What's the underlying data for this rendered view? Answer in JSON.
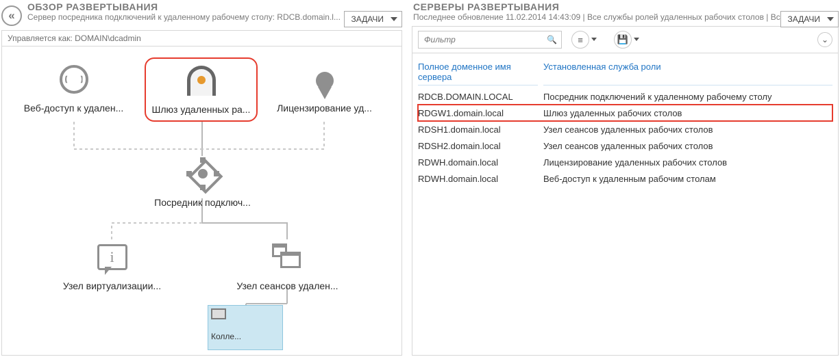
{
  "left": {
    "title": "ОБЗОР РАЗВЕРТЫВАНИЯ",
    "subtitle": "Сервер посредника подключений к удаленному рабочему столу: RDCB.domain.l...",
    "tasks": "ЗАДАЧИ",
    "managed_as": "Управляется как: DOMAIN\\dcadmin",
    "nodes": {
      "web": "Веб-доступ к удален...",
      "gateway": "Шлюз удаленных ра...",
      "licensing": "Лицензирование уд...",
      "broker": "Посредник подключ...",
      "virt": "Узел виртуализации...",
      "session": "Узел сеансов удален..."
    },
    "collection": "Колле..."
  },
  "right": {
    "title": "СЕРВЕРЫ РАЗВЕРТЫВАНИЯ",
    "subtitle": "Последнее обновление 11.02.2014 14:43:09 | Все службы ролей удаленных рабочих столов  | Всег...",
    "tasks": "ЗАДАЧИ",
    "filter_placeholder": "Фильтр",
    "columns": {
      "server": "Полное доменное имя сервера",
      "role": "Установленная служба роли"
    },
    "rows": [
      {
        "server": "RDCB.DOMAIN.LOCAL",
        "role": "Посредник подключений к удаленному рабочему столу",
        "hl": false
      },
      {
        "server": "RDGW1.domain.local",
        "role": "Шлюз удаленных рабочих столов",
        "hl": true
      },
      {
        "server": "RDSH1.domain.local",
        "role": "Узел сеансов удаленных рабочих столов",
        "hl": false
      },
      {
        "server": "RDSH2.domain.local",
        "role": "Узел сеансов удаленных рабочих столов",
        "hl": false
      },
      {
        "server": "RDWH.domain.local",
        "role": "Лицензирование удаленных рабочих столов",
        "hl": false
      },
      {
        "server": "RDWH.domain.local",
        "role": "Веб-доступ к удаленным рабочим столам",
        "hl": false
      }
    ]
  }
}
